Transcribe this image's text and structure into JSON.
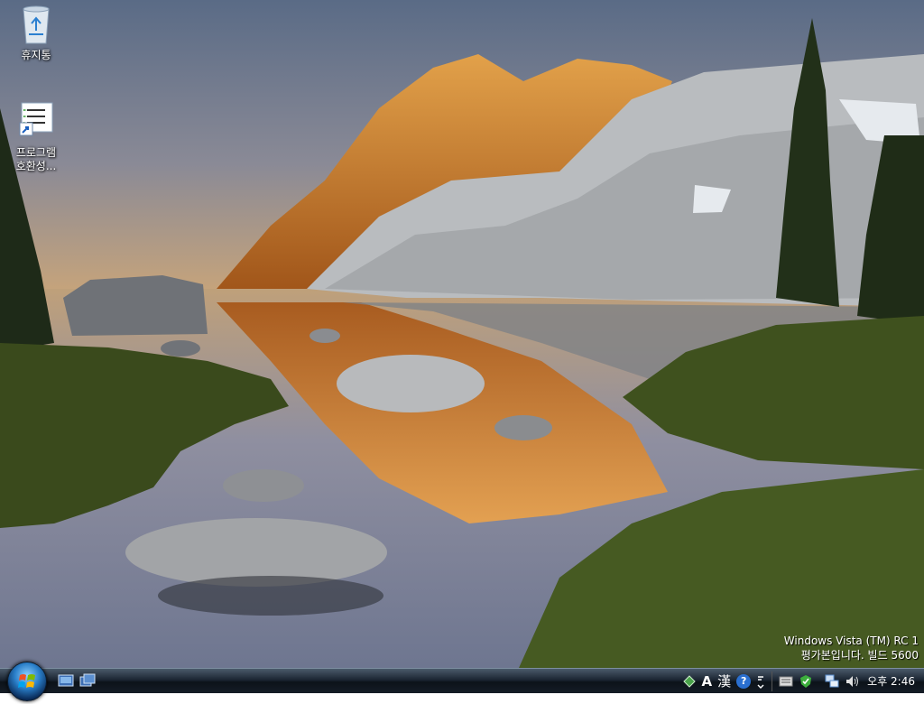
{
  "desktop": {
    "icons": [
      {
        "label": "휴지통"
      },
      {
        "label": "프로그램 호환성..."
      }
    ],
    "watermark": {
      "line1": "Windows Vista (TM) RC 1",
      "line2": "평가본입니다. 빌드 5600"
    }
  },
  "taskbar": {
    "tray": {
      "lang_text": "A",
      "hanja_text": "漢",
      "help_text": "?",
      "clock": "오후 2:46"
    }
  }
}
